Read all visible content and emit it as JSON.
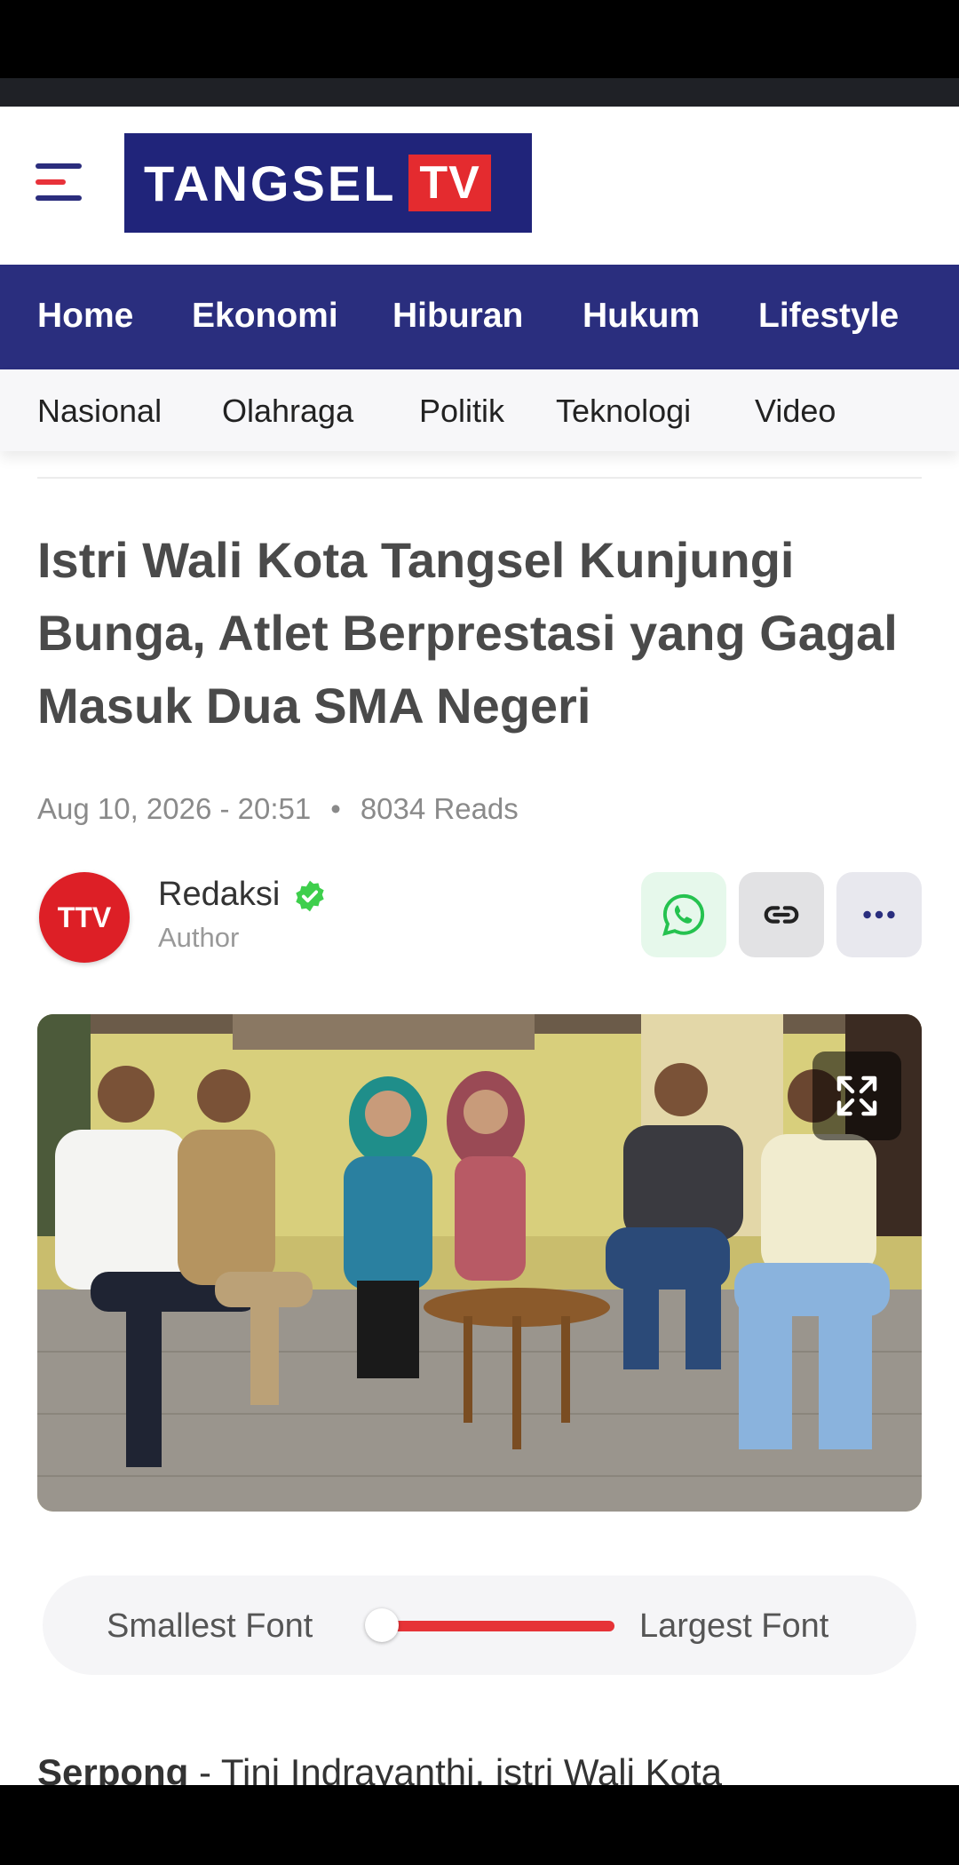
{
  "brand": {
    "logo_text": "TANGSEL",
    "logo_badge": "TV",
    "primary_color": "#2a2e7e",
    "accent_color": "#e42b2f"
  },
  "nav_primary": [
    "Home",
    "Ekonomi",
    "Hiburan",
    "Hukum",
    "Lifestyle"
  ],
  "nav_secondary": [
    "Nasional",
    "Olahraga",
    "Politik",
    "Teknologi",
    "Video"
  ],
  "article": {
    "title": "Istri Wali Kota Tangsel Kunjungi Bunga, Atlet Berprestasi yang Gagal Masuk Dua SMA Negeri",
    "date": "Aug 10, 2026 - 20:51",
    "reads": "8034 Reads",
    "lead_location": "Serpong",
    "lead_text": " - Tini Indrayanthi, istri Wali Kota"
  },
  "author": {
    "avatar_text": "TTV",
    "name": "Redaksi",
    "role": "Author",
    "verified": true
  },
  "share_buttons": [
    "whatsapp-icon",
    "link-icon",
    "more-icon"
  ],
  "font_control": {
    "min_label": "Smallest Font",
    "max_label": "Largest Font",
    "level": 0.0
  }
}
